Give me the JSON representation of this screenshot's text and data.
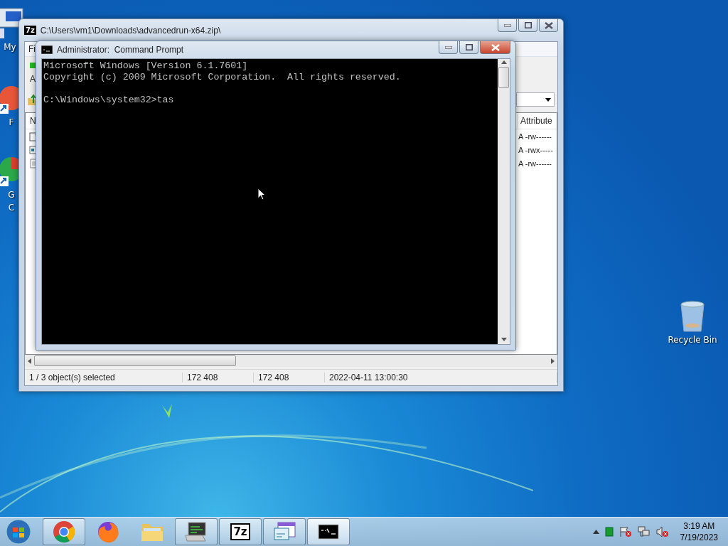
{
  "desktop_icons": [
    {
      "kind": "computer",
      "lines": [
        "My"
      ]
    },
    {
      "kind": "red",
      "lines": [
        "F"
      ]
    },
    {
      "kind": "green",
      "lines": [
        "G",
        "C"
      ]
    },
    {
      "kind": "bin",
      "lines": [
        "Recycle Bin"
      ]
    }
  ],
  "archive_window": {
    "logo": "7z",
    "title": "C:\\Users\\vm1\\Downloads\\advancedrun-x64.zip\\",
    "menu": [
      "Fi"
    ],
    "toolbar_label": "A",
    "columns": [
      "N",
      "Attribute"
    ],
    "rows": [
      {
        "kind": "exe",
        "attributes": "A -rw------"
      },
      {
        "kind": "window",
        "attributes": "A -rwx-----"
      },
      {
        "kind": "text",
        "attributes": "A -rw------"
      }
    ],
    "status_bar": [
      "1 / 3 object(s) selected",
      "172 408",
      "172 408",
      "2022-04-11 13:00:30"
    ]
  },
  "console_window": {
    "title": "Administrator:  Command Prompt",
    "output": [
      "Microsoft Windows [Version 6.1.7601]",
      "Copyright (c) 2009 Microsoft Corporation.  All rights reserved."
    ],
    "prompt": "C:\\Windows\\system32>tas"
  },
  "taskbar": {
    "apps": [
      {
        "kind": "chrome",
        "running": true,
        "active": false
      },
      {
        "kind": "firefox",
        "running": false,
        "active": false
      },
      {
        "kind": "folder",
        "running": false,
        "active": false
      },
      {
        "kind": "monitor",
        "running": true,
        "active": false
      },
      {
        "kind": "sevenzip",
        "running": true,
        "active": false,
        "text": "7z"
      },
      {
        "kind": "window",
        "running": true,
        "active": false
      },
      {
        "kind": "console",
        "running": true,
        "active": true
      }
    ],
    "clock": {
      "time": "3:19 AM",
      "date": "7/19/2023"
    }
  }
}
